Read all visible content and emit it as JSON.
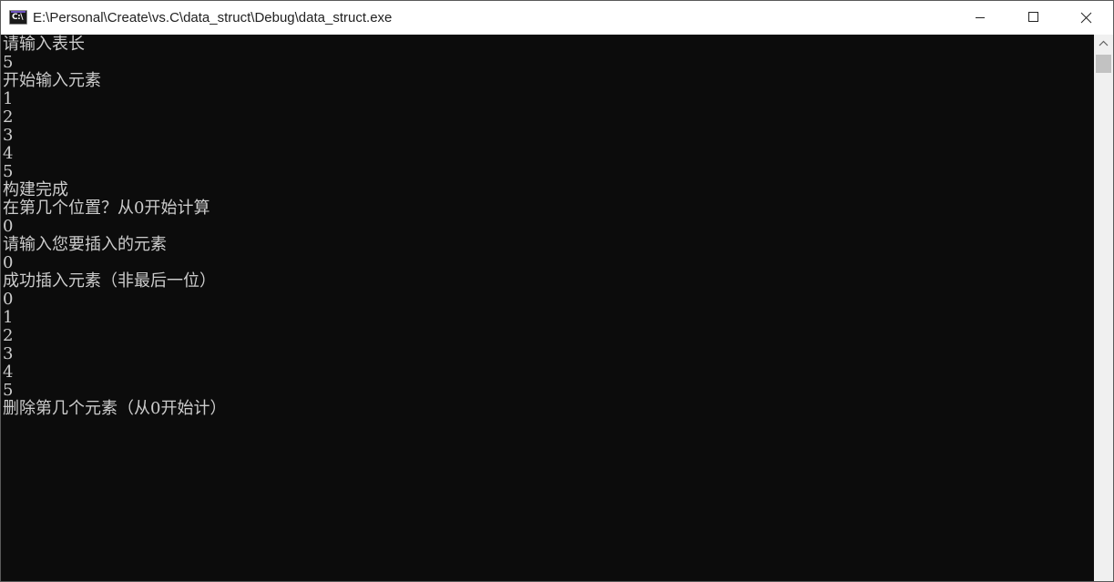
{
  "window": {
    "title": "E:\\Personal\\Create\\vs.C\\data_struct\\Debug\\data_struct.exe",
    "icon_label": "C:\\",
    "icon": "console-app-icon",
    "controls": {
      "minimize_icon": "minimize-icon",
      "maximize_icon": "maximize-icon",
      "close_icon": "close-icon"
    }
  },
  "console": {
    "background": "#0c0c0c",
    "foreground": "#cccccc",
    "lines": [
      "请输入表长",
      "5",
      "开始输入元素",
      "1",
      "2",
      "3",
      "4",
      "5",
      "构建完成",
      "在第几个位置？从0开始计算",
      "0",
      "请输入您要插入的元素",
      "0",
      "成功插入元素（非最后一位）",
      "0",
      "1",
      "2",
      "3",
      "4",
      "5",
      "删除第几个元素（从0开始计）"
    ]
  },
  "scrollbar": {
    "up_icon": "scroll-up-arrow-icon"
  }
}
